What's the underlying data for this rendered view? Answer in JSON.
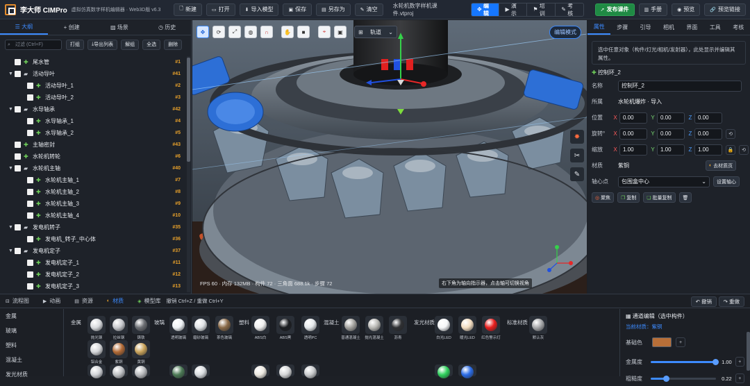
{
  "app": {
    "name": "李大师 CIMPro",
    "subtitle": "虚拟仿真数字样机编辑器 · Web3D版 v6.3"
  },
  "toolbar": {
    "new": "新建",
    "open": "打开",
    "import": "导入模型",
    "save": "保存",
    "save_as": "另存为",
    "clear": "清空",
    "filename": "水轮机数字样机课件.vtproj",
    "modes": [
      "编辑",
      "演示",
      "培训",
      "考核"
    ],
    "publish": "发布课件",
    "manual": "手册",
    "preview": "预览",
    "preview_link": "预览链接"
  },
  "left_panel": {
    "tabs": [
      "大纲",
      "创建",
      "场景",
      "历史"
    ],
    "search_placeholder": "过滤 (Ctrl+F)",
    "buttons": [
      "打组",
      "导出列表",
      "解组",
      "全选",
      "删除"
    ],
    "tree": [
      {
        "label": "尾水管",
        "num": "#1",
        "level": 0,
        "icon": "part",
        "twisty": ""
      },
      {
        "label": "活动导叶",
        "num": "#41",
        "level": 0,
        "icon": "folder",
        "twisty": "▼"
      },
      {
        "label": "活动导叶_1",
        "num": "#2",
        "level": 1,
        "icon": "part",
        "twisty": ""
      },
      {
        "label": "活动导叶_2",
        "num": "#3",
        "level": 1,
        "icon": "part",
        "twisty": ""
      },
      {
        "label": "水导轴承",
        "num": "#42",
        "level": 0,
        "icon": "folder",
        "twisty": "▼"
      },
      {
        "label": "水导轴承_1",
        "num": "#4",
        "level": 1,
        "icon": "part",
        "twisty": ""
      },
      {
        "label": "水导轴承_2",
        "num": "#5",
        "level": 1,
        "icon": "part",
        "twisty": ""
      },
      {
        "label": "主轴密封",
        "num": "#43",
        "level": 0,
        "icon": "part",
        "twisty": ""
      },
      {
        "label": "水轮机转轮",
        "num": "#6",
        "level": 0,
        "icon": "part",
        "twisty": ""
      },
      {
        "label": "水轮机主轴",
        "num": "#40",
        "level": 0,
        "icon": "folder",
        "twisty": "▼"
      },
      {
        "label": "水轮机主轴_1",
        "num": "#7",
        "level": 1,
        "icon": "part",
        "twisty": ""
      },
      {
        "label": "水轮机主轴_2",
        "num": "#8",
        "level": 1,
        "icon": "part",
        "twisty": ""
      },
      {
        "label": "水轮机主轴_3",
        "num": "#9",
        "level": 1,
        "icon": "part",
        "twisty": ""
      },
      {
        "label": "水轮机主轴_4",
        "num": "#10",
        "level": 1,
        "icon": "part",
        "twisty": ""
      },
      {
        "label": "发电机转子",
        "num": "#35",
        "level": 0,
        "icon": "folder",
        "twisty": "▼"
      },
      {
        "label": "发电机_转子_中心体",
        "num": "#36",
        "level": 1,
        "icon": "part",
        "twisty": ""
      },
      {
        "label": "发电机定子",
        "num": "#37",
        "level": 0,
        "icon": "folder",
        "twisty": "▼"
      },
      {
        "label": "发电机定子_1",
        "num": "#11",
        "level": 1,
        "icon": "part",
        "twisty": ""
      },
      {
        "label": "发电机定子_2",
        "num": "#12",
        "level": 1,
        "icon": "part",
        "twisty": ""
      },
      {
        "label": "发电机定子_3",
        "num": "#13",
        "level": 1,
        "icon": "part",
        "twisty": ""
      }
    ]
  },
  "viewport": {
    "tool_icons": [
      "select-icon",
      "orbit-icon",
      "move-icon",
      "globe-icon",
      "magnet-icon",
      "hand-icon",
      "box-icon",
      "measure-icon",
      "camera-icon"
    ],
    "track_select": "轨道",
    "edit_badge": "编辑模式",
    "stats": "FPS 60 · 内存 132MB · 构件 72 · 三角面 688.1k · 步骤 72",
    "hint": "右下角为轴向指示器，点击轴可切换视角"
  },
  "right_panel": {
    "tabs": [
      "属性",
      "步骤",
      "引导",
      "相机",
      "界面",
      "工具",
      "考核"
    ],
    "tip": "选中任意对象（构件/灯光/相机/发射器），此处显示并编辑其属性。",
    "selected": "控制环_2",
    "name_label": "名称",
    "name_value": "控制环_2",
    "parent_label": "所属",
    "parent_value": "水轮机爆炸 · 导入",
    "position_label": "位置",
    "position": [
      "0.00",
      "0.00",
      "0.00"
    ],
    "rotation_label": "旋转°",
    "rotation": [
      "0.00",
      "0.00",
      "0.00"
    ],
    "scale_label": "缩放",
    "scale": [
      "1.00",
      "1.00",
      "1.00"
    ],
    "material_label": "材质",
    "material_value": "紫铜",
    "remove_material": "去材质页",
    "pivot_label": "轴心点",
    "pivot_value": "包围盒中心",
    "set_pivot": "设置轴心",
    "actions": [
      "聚焦",
      "复制",
      "批量复制"
    ]
  },
  "bottom": {
    "tabs": [
      "流程图",
      "动画",
      "资源",
      "材质",
      "模型库"
    ],
    "undo_hint": "撤销 Ctrl+Z / 重做 Ctrl+Y",
    "undo": "撤销",
    "redo": "重做",
    "categories": [
      "金属",
      "玻璃",
      "塑料",
      "混凝土",
      "发光材质"
    ],
    "groups": {
      "metal": "金属",
      "glass": "玻璃",
      "plastic": "塑料",
      "concrete": "混凝土",
      "emissive": "发光材质",
      "standard": "标准材质"
    },
    "swatches": [
      {
        "label": "抛光钢",
        "color": "#d9dbde"
      },
      {
        "label": "拉丝钢",
        "color": "#c8cace"
      },
      {
        "label": "铸铁",
        "color": "#6b6e73"
      },
      {
        "label": "透明玻璃",
        "color": "#eef2f5"
      },
      {
        "label": "磨砂玻璃",
        "color": "#dfe3e6"
      },
      {
        "label": "茶色玻璃",
        "color": "#8a6a48"
      },
      {
        "label": "ABS白",
        "color": "#eeeeee"
      },
      {
        "label": "ABS黑",
        "color": "#1b1d20"
      },
      {
        "label": "透明PC",
        "color": "#e4e8eb"
      },
      {
        "label": "普通混凝土",
        "color": "#a3a29e"
      },
      {
        "label": "抛光混凝土",
        "color": "#b9b8b4"
      },
      {
        "label": "沥青",
        "color": "#2f3033"
      },
      {
        "label": "白光LED",
        "color": "#f5f6f8"
      },
      {
        "label": "暖光LED",
        "color": "#f2dcc0"
      },
      {
        "label": "红色警示灯",
        "color": "#e81d1d"
      },
      {
        "label": "默认灰",
        "color": "#a7a8aa"
      },
      {
        "label": "铝合金",
        "color": "#d4d6d9"
      },
      {
        "label": "紫铜",
        "color": "#b26a35"
      },
      {
        "label": "黄铜",
        "color": "#c9a35a"
      }
    ],
    "row3_colors": [
      "#d2d4d8",
      "#bfc1c4",
      "#b9bbbe",
      "#4c7a55",
      "#d8dcdf",
      "#ece8e0",
      "#d4d5d6",
      "#c9cbcd",
      "#2fd05c",
      "#2a6be6"
    ],
    "editor": {
      "title": "通道编辑（选中构件）",
      "current": "当前材质：紫铜",
      "base_color_label": "基础色",
      "base_color": "#b86f38",
      "metalness_label": "金属度",
      "metalness": "1.00",
      "roughness_label": "粗糙度",
      "roughness": "0.22"
    }
  }
}
